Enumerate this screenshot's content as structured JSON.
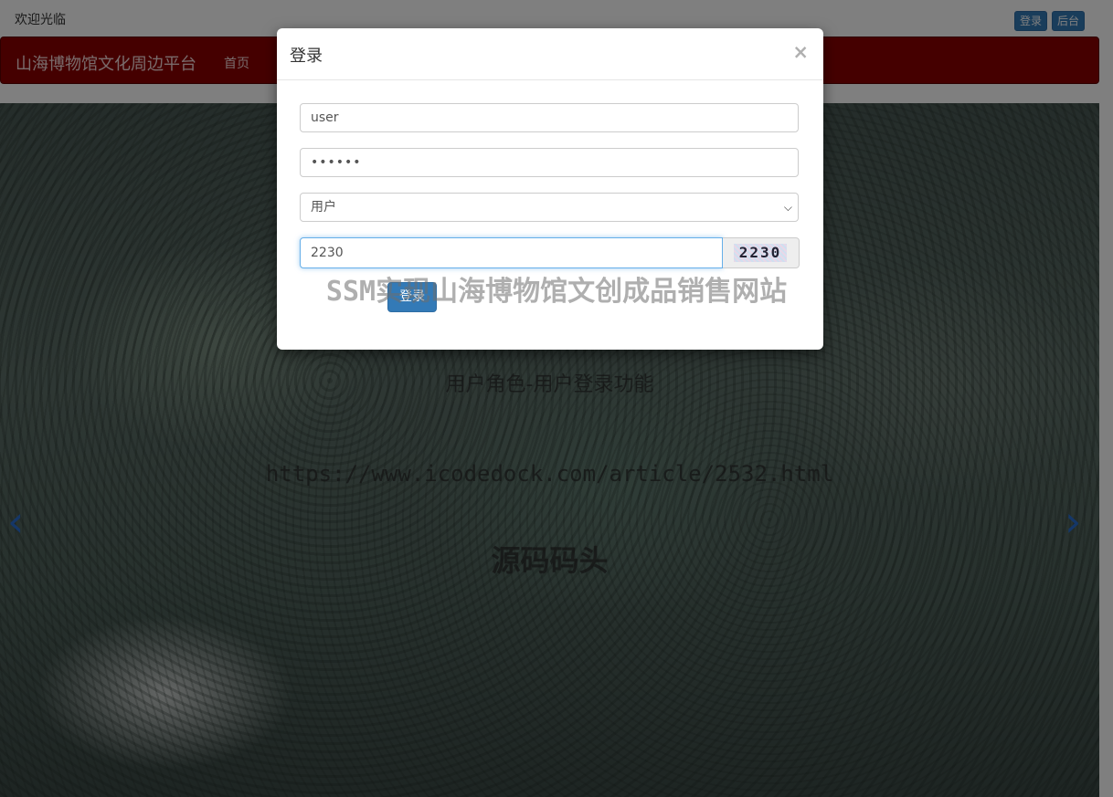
{
  "topbar": {
    "welcome": "欢迎光临",
    "login_label": "登录",
    "admin_label": "后台"
  },
  "navbar": {
    "brand": "山海博物馆文化周边平台",
    "home": "首页",
    "bg_color": "#8b0000"
  },
  "carousel": {
    "caption_line1": "用户角色-用户登录功能",
    "caption_url": "https://www.icodedock.com/article/2532.html",
    "caption_brand": "源码码头",
    "prev_icon": "chevron-left-icon",
    "next_icon": "chevron-right-icon"
  },
  "modal": {
    "title": "登录",
    "close_glyph": "×",
    "username_value": "user",
    "password_value": "••••••",
    "role_selected": "用户",
    "captcha_input_value": "2230",
    "captcha_image_text": "2230",
    "submit_label": "登录"
  },
  "watermark": "SSM实现山海博物馆文创成品销售网站"
}
